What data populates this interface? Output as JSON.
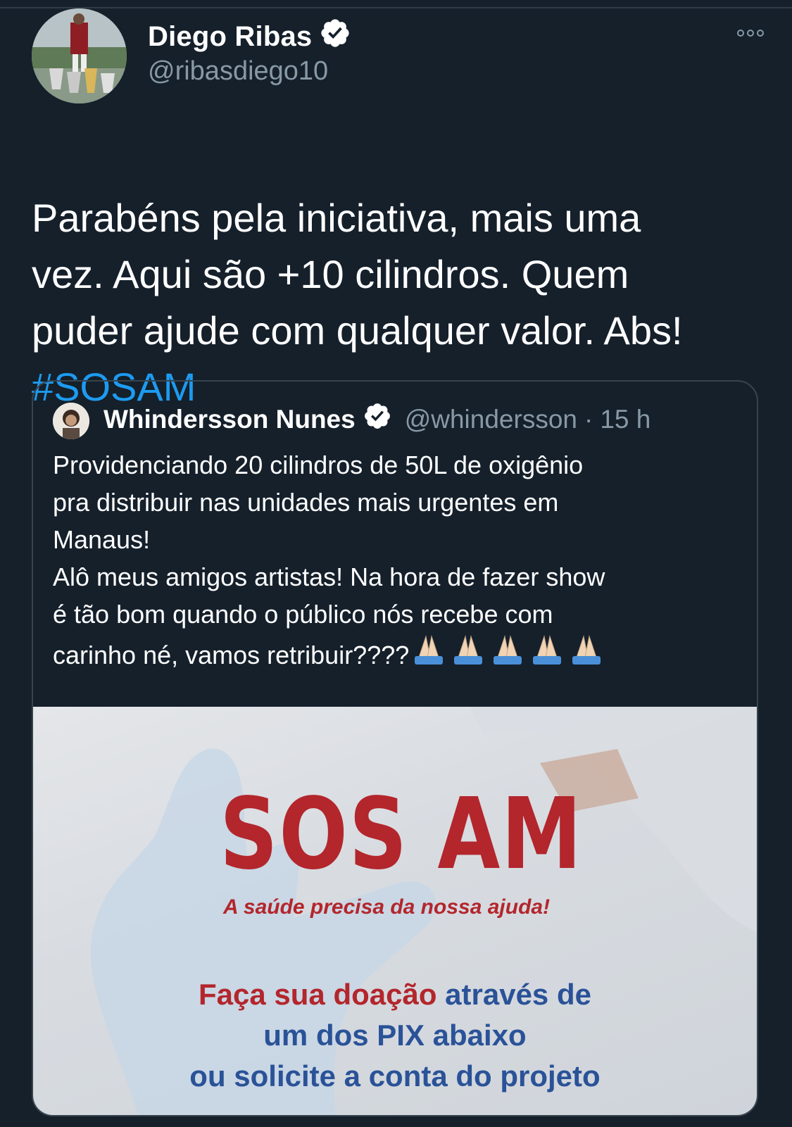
{
  "author": {
    "display_name": "Diego Ribas",
    "handle": "@ribasdiego10",
    "verified": true,
    "avatar_icon": "profile-photo-trophies"
  },
  "tweet": {
    "text": "Parabéns pela iniciativa, mais uma\nvez. Aqui são +10 cilindros. Quem\npuder ajude com qualquer valor. Abs!",
    "hashtag": "#SOSAM"
  },
  "quoted": {
    "display_name": "Whindersson Nunes",
    "handle": "@whindersson",
    "separator": "·",
    "time": "15 h",
    "verified": true,
    "lines": [
      "Providenciando 20 cilindros de 50L de oxigênio",
      "pra distribuir nas unidades mais urgentes em",
      "Manaus!",
      "Alô meus amigos artistas! Na hora de fazer show",
      "é tão bom quando o público nós recebe com",
      "carinho né, vamos retribuir????"
    ],
    "emoji": "folded-hands x5",
    "media": {
      "title": "SOS AM",
      "subtitle": "A saúde precisa da nossa ajuda!",
      "cta_red": "Faça sua doação",
      "cta_line1_rest": " através de",
      "cta_line2": "um dos PIX abaixo",
      "cta_line3": "ou solicite a conta do projeto"
    }
  },
  "colors": {
    "background": "#15202b",
    "link": "#1d9bf0",
    "secondary_text": "#8899a6",
    "sos_red": "#b3262c",
    "pix_blue": "#2a5298"
  }
}
